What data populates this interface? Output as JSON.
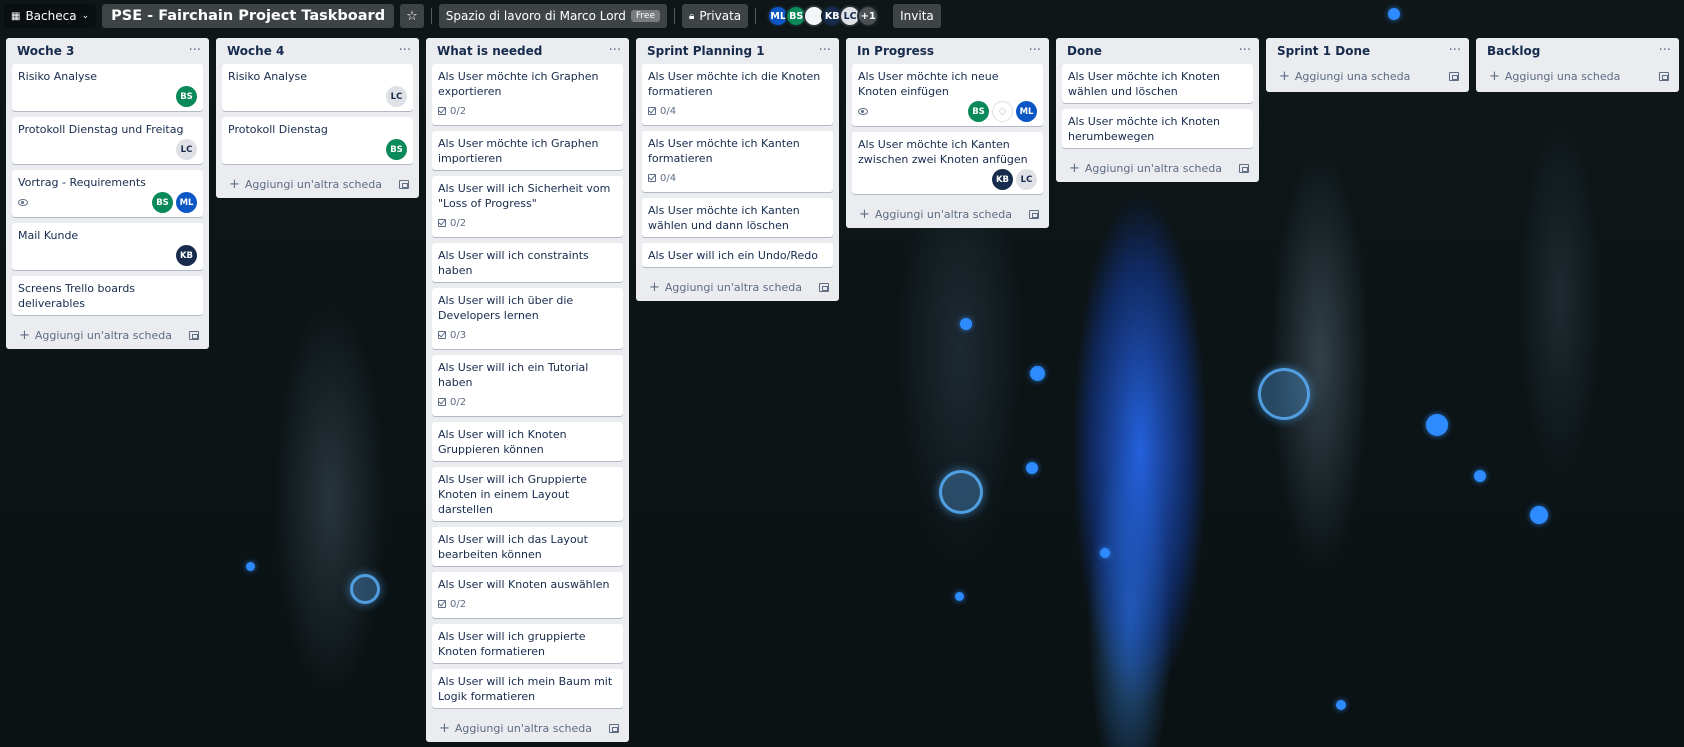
{
  "colors": {
    "bs": "#0a8a5a",
    "ml": "#0c57c4",
    "kb": "#172b4d",
    "lc_bg": "#dfe1e6"
  },
  "header": {
    "board_menu_label": "Bacheca",
    "board_title": "PSE - Fairchain Project Taskboard",
    "workspace_label": "Spazio di lavoro di Marco Lord",
    "workspace_badge": "Free",
    "visibility_label": "Privata",
    "members": [
      "ML",
      "BS",
      "",
      "KB",
      "LC"
    ],
    "members_more": "+1",
    "invite_label": "Invita"
  },
  "lists": [
    {
      "title": "Woche 3",
      "add_label": "Aggiungi un'altra scheda",
      "cards": [
        {
          "title": "Risiko Analyse",
          "members": [
            "BS"
          ]
        },
        {
          "title": "Protokoll Dienstag und Freitag",
          "members": [
            "LC"
          ]
        },
        {
          "title": "Vortrag - Requirements",
          "watch": true,
          "members": [
            "BS",
            "ML"
          ]
        },
        {
          "title": "Mail Kunde",
          "members": [
            "KB"
          ]
        },
        {
          "title": "Screens Trello boards deliverables"
        }
      ]
    },
    {
      "title": "Woche 4",
      "add_label": "Aggiungi un'altra scheda",
      "cards": [
        {
          "title": "Risiko Analyse",
          "members": [
            "LC"
          ]
        },
        {
          "title": "Protokoll Dienstag",
          "members": [
            "BS"
          ]
        }
      ]
    },
    {
      "title": "What is needed",
      "add_label": "Aggiungi un'altra scheda",
      "cards": [
        {
          "title": "Als User möchte ich Graphen exportieren",
          "checklist": "0/2"
        },
        {
          "title": "Als User möchte ich Graphen importieren"
        },
        {
          "title": "Als User will ich Sicherheit vom \"Loss of Progress\"",
          "checklist": "0/2"
        },
        {
          "title": "Als User will ich constraints haben"
        },
        {
          "title": "Als User will ich über die Developers lernen",
          "checklist": "0/3"
        },
        {
          "title": "Als User will ich ein Tutorial haben",
          "checklist": "0/2"
        },
        {
          "title": "Als User will ich Knoten Gruppieren können"
        },
        {
          "title": "Als User will ich Gruppierte Knoten in einem Layout darstellen"
        },
        {
          "title": "Als User will ich das Layout bearbeiten können"
        },
        {
          "title": "Als User will Knoten auswählen",
          "checklist": "0/2"
        },
        {
          "title": "Als User will ich gruppierte Knoten formatieren"
        },
        {
          "title": "Als User will ich mein Baum mit Logik formatieren"
        }
      ]
    },
    {
      "title": "Sprint Planning 1",
      "add_label": "Aggiungi un'altra scheda",
      "cards": [
        {
          "title": "Als User möchte ich die Knoten formatieren",
          "checklist": "0/4"
        },
        {
          "title": "Als User möchte ich Kanten formatieren",
          "checklist": "0/4"
        },
        {
          "title": "Als User möchte ich Kanten wählen und dann löschen"
        },
        {
          "title": "Als User will ich ein Undo/Redo"
        }
      ]
    },
    {
      "title": "In Progress",
      "add_label": "Aggiungi un'altra scheda",
      "cards": [
        {
          "title": "Als User möchte ich neue Knoten einfügen",
          "watch": true,
          "members": [
            "BS",
            "?",
            "ML"
          ]
        },
        {
          "title": "Als User möchte ich Kanten zwischen zwei Knoten anfügen",
          "members": [
            "KB",
            "LC"
          ]
        }
      ]
    },
    {
      "title": "Done",
      "add_label": "Aggiungi un'altra scheda",
      "cards": [
        {
          "title": "Als User möchte ich Knoten wählen und löschen"
        },
        {
          "title": "Als User möchte ich Knoten herumbewegen"
        }
      ]
    },
    {
      "title": "Sprint 1 Done",
      "add_label": "Aggiungi una scheda",
      "cards": []
    },
    {
      "title": "Backlog",
      "add_label": "Aggiungi una scheda",
      "cards": []
    }
  ]
}
